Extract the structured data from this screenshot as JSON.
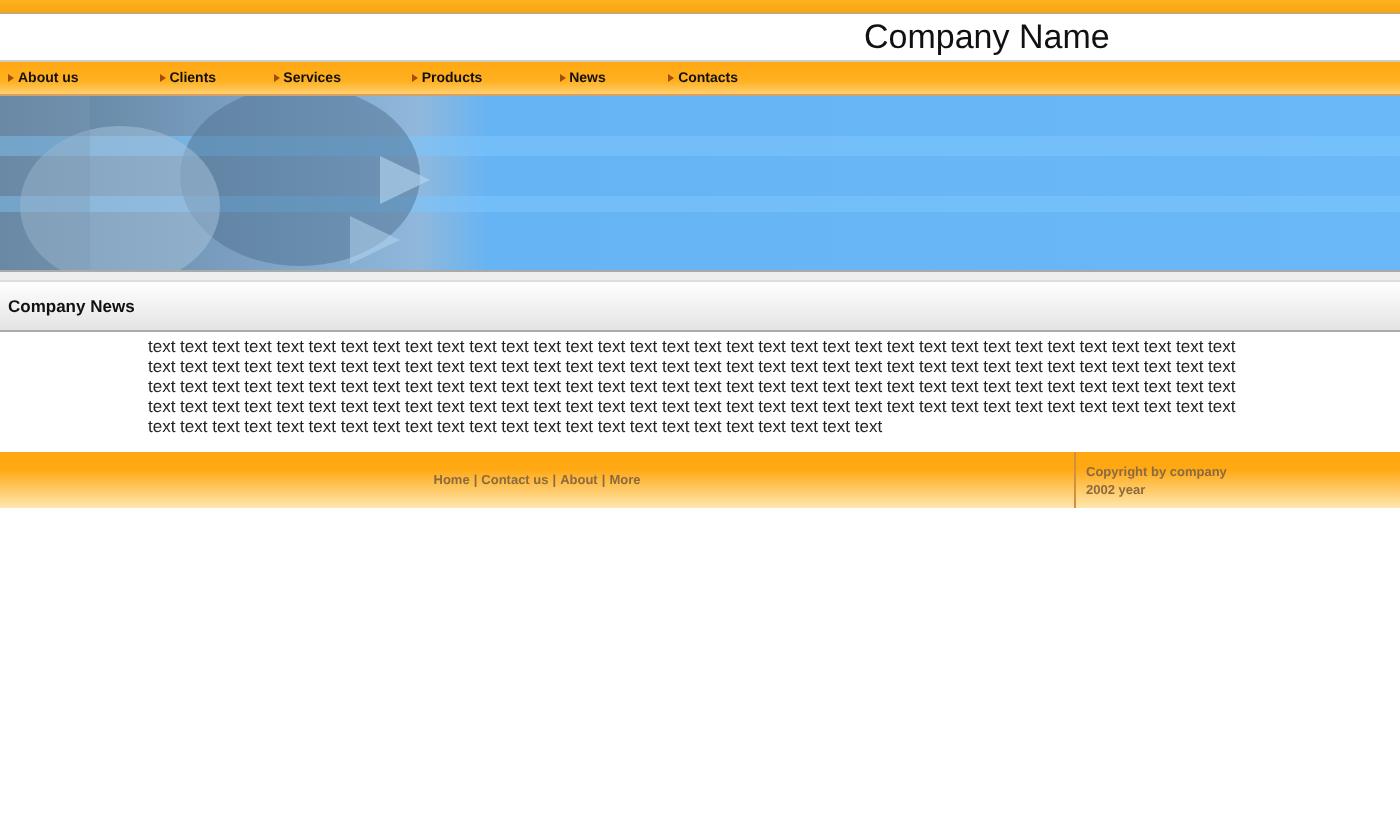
{
  "header": {
    "title": "Company Name"
  },
  "nav": [
    {
      "label": "About us"
    },
    {
      "label": "Clients"
    },
    {
      "label": "Services"
    },
    {
      "label": "Products"
    },
    {
      "label": "News"
    },
    {
      "label": "Contacts"
    }
  ],
  "section": {
    "title": "Company News",
    "body": "text text text text text text text text text text text text text text text text text text text text text text text text text text text text text text text text text text text text text text text text text text text text text text text text text text text text text text text text text text text text text text text text text text text text text text text text text text text text text text text text text text text text text text text text text text text text text text text text text text text text text text text text text text text text text text text text text text text text text text text text text text text text text text text text text text text text text text text text text text text text text text text text text text text text text text text text text text text text text text text"
  },
  "footer": {
    "links": [
      "Home",
      "Contact us",
      "About",
      "More"
    ],
    "separator": "|",
    "copyright": [
      "Copyright by company",
      "2002 year"
    ]
  }
}
